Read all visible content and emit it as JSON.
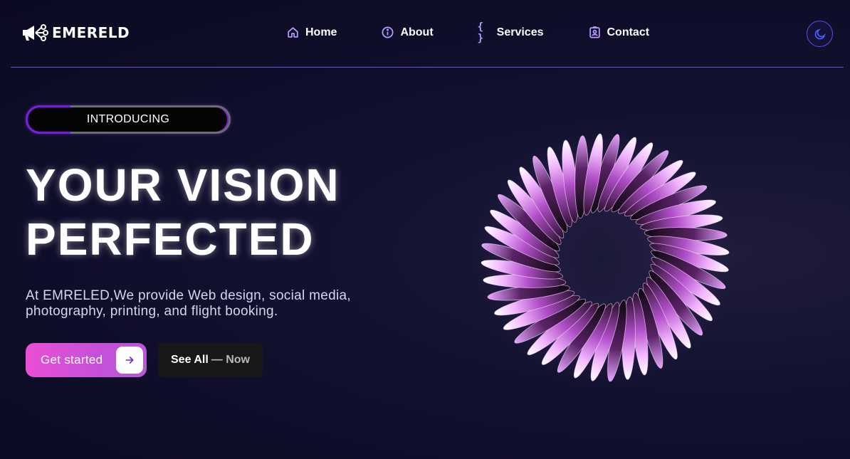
{
  "brand": {
    "name": "EMERELD",
    "logo_icon": "megaphone-network-icon"
  },
  "nav": {
    "items": [
      {
        "label": "Home",
        "icon": "home-icon"
      },
      {
        "label": "About",
        "icon": "info-icon"
      },
      {
        "label": "Services",
        "icon": "braces-icon",
        "glyph": "{ }"
      },
      {
        "label": "Contact",
        "icon": "contact-card-icon"
      }
    ],
    "theme_toggle_icon": "moon-icon"
  },
  "hero": {
    "badge": "INTRODUCING",
    "headline_line1": "YOUR VISION",
    "headline_line2": "PERFECTED",
    "description": "At EMRELED,We provide Web design, social media, photography, printing, and flight booking.",
    "primary_button": "Get started",
    "secondary_button_main": "See All",
    "secondary_button_muted": "— Now",
    "art_icon": "iridescent-torus-illustration"
  },
  "colors": {
    "background": "#0b0a22",
    "accent_purple": "#b79cff",
    "nav_divider": "#6a55c8",
    "primary_gradient_start": "#e84fd6",
    "primary_gradient_end": "#b55ad6",
    "badge_ring": "#7b18f0",
    "toggle_border": "#5a4ee0"
  }
}
